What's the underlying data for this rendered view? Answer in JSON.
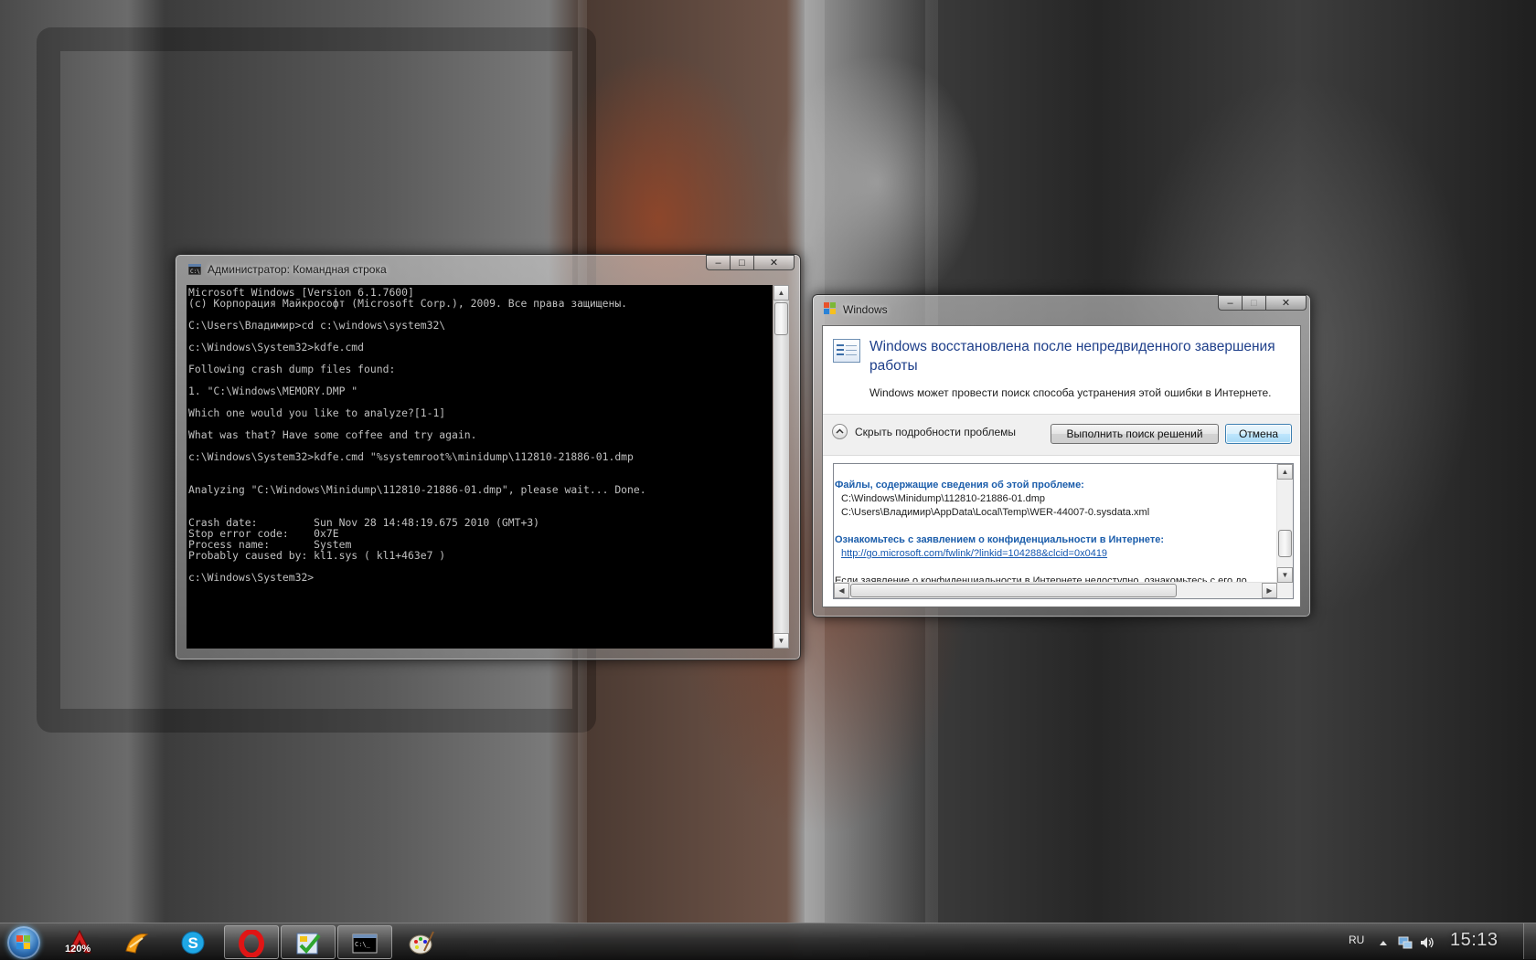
{
  "console": {
    "title": "Администратор: Командная строка",
    "lines": [
      "Microsoft Windows [Version 6.1.7600]",
      "(c) Корпорация Майкрософт (Microsoft Corp.), 2009. Все права защищены.",
      "",
      "C:\\Users\\Владимир>cd c:\\windows\\system32\\",
      "",
      "c:\\Windows\\System32>kdfe.cmd",
      "",
      "Following crash dump files found:",
      "",
      "1. \"C:\\Windows\\MEMORY.DMP \"",
      "",
      "Which one would you like to analyze?[1-1]",
      "",
      "What was that? Have some coffee and try again.",
      "",
      "c:\\Windows\\System32>kdfe.cmd \"%systemroot%\\minidump\\112810-21886-01.dmp",
      "",
      "",
      "Analyzing \"C:\\Windows\\Minidump\\112810-21886-01.dmp\", please wait... Done.",
      "",
      "",
      "Crash date:         Sun Nov 28 14:48:19.675 2010 (GMT+3)",
      "Stop error code:    0x7E",
      "Process name:       System",
      "Probably caused by: kl1.sys ( kl1+463e7 )",
      "",
      "c:\\Windows\\System32>"
    ]
  },
  "wer_dialog": {
    "title": "Windows",
    "heading": "Windows восстановлена после непредвиденного завершения работы",
    "subtitle": "Windows может провести поиск способа устранения этой ошибки в Интернете.",
    "details_toggle_label": "Скрыть подробности проблемы",
    "search_button": "Выполнить поиск решений",
    "cancel_button": "Отмена",
    "details": {
      "files_heading": "Файлы, содержащие сведения об этой проблеме:",
      "files": [
        "C:\\Windows\\Minidump\\112810-21886-01.dmp",
        "C:\\Users\\Владимир\\AppData\\Local\\Temp\\WER-44007-0.sysdata.xml"
      ],
      "privacy_heading": "Ознакомьтесь с заявлением о конфиденциальности в Интернете:",
      "privacy_link": "http://go.microsoft.com/fwlink/?linkid=104288&clcid=0x0419",
      "offline_text": "Если заявление о конфиденциальности в Интернете недоступно, ознакомьтесь с его до"
    }
  },
  "taskbar": {
    "pinned": [
      {
        "icon": "acrobat-icon",
        "badge": "120%"
      },
      {
        "icon": "winamp-icon"
      },
      {
        "icon": "skype-icon"
      },
      {
        "icon": "opera-icon"
      },
      {
        "icon": "checkmark-app-icon"
      },
      {
        "icon": "command-prompt-icon"
      },
      {
        "icon": "paint-icon"
      }
    ],
    "tray": {
      "language": "RU",
      "clock": "15:13"
    }
  },
  "colors": {
    "console_bg": "#000000",
    "console_fg": "#c0c0c0",
    "wer_heading": "#1e3f8a",
    "link": "#1558b0"
  }
}
